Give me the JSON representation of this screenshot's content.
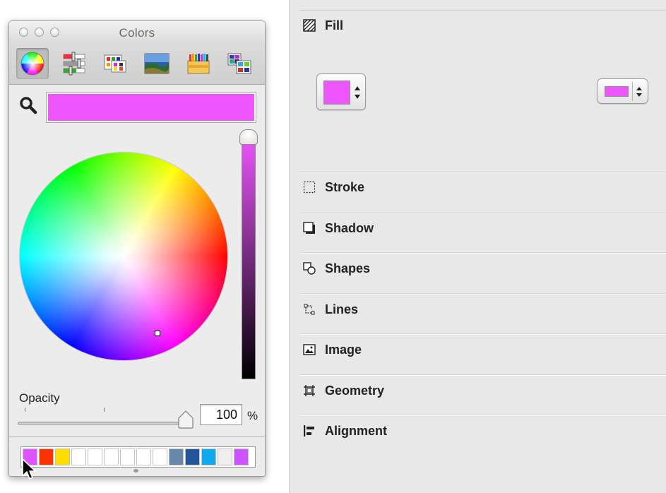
{
  "colors_window": {
    "title": "Colors",
    "tabs": [
      {
        "name": "color-wheel-tab",
        "icon": "color-wheel-icon",
        "selected": true
      },
      {
        "name": "color-sliders-tab",
        "icon": "sliders-icon",
        "selected": false
      },
      {
        "name": "color-palettes-tab",
        "icon": "palettes-icon",
        "selected": false
      },
      {
        "name": "image-palettes-tab",
        "icon": "image-icon",
        "selected": false
      },
      {
        "name": "crayons-tab",
        "icon": "crayons-icon",
        "selected": false
      },
      {
        "name": "custom-palettes-tab",
        "icon": "custom-palette-icon",
        "selected": false
      }
    ],
    "current_color": "#ee55ff",
    "opacity": {
      "label": "Opacity",
      "value": "100",
      "unit": "%",
      "fraction": 1.0
    },
    "swatches": [
      "#dd55ff",
      "#ff3300",
      "#ffdd00",
      "#ffffff",
      "#ffffff",
      "#ffffff",
      "#ffffff",
      "#ffffff",
      "#ffffff",
      "#6688aa",
      "#225599",
      "#11aaee",
      "#eeeeee",
      "#cc55ff"
    ]
  },
  "inspector": {
    "sections": [
      {
        "label": "Fill",
        "icon": "fill-icon"
      },
      {
        "label": "Stroke",
        "icon": "stroke-icon"
      },
      {
        "label": "Shadow",
        "icon": "shadow-icon"
      },
      {
        "label": "Shapes",
        "icon": "shapes-icon"
      },
      {
        "label": "Lines",
        "icon": "lines-icon"
      },
      {
        "label": "Image",
        "icon": "image-icon"
      },
      {
        "label": "Geometry",
        "icon": "geometry-icon"
      },
      {
        "label": "Alignment",
        "icon": "alignment-icon"
      }
    ],
    "fill_color": "#ee55ff"
  }
}
